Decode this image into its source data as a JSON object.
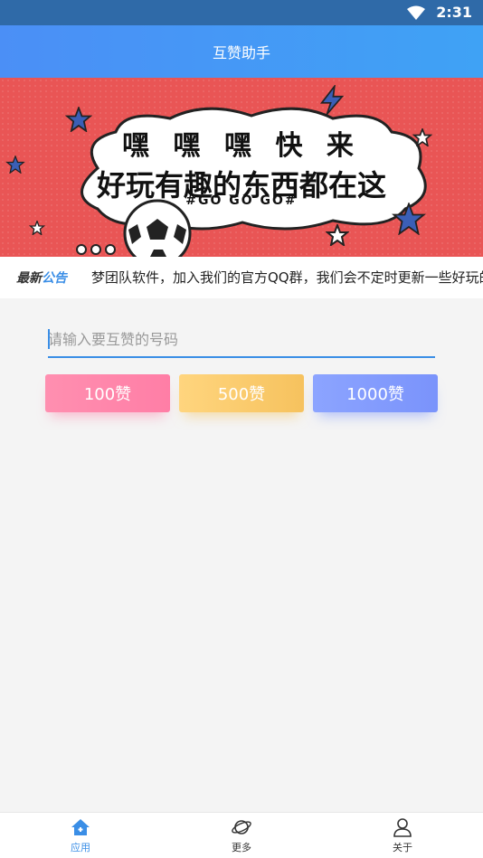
{
  "status_bar": {
    "time": "2:31",
    "wifi_icon": "wifi-icon"
  },
  "app_bar": {
    "title": "互赞助手"
  },
  "banner": {
    "line1": "嘿 嘿 嘿 快 来",
    "line2": "好玩有趣的东西都在这",
    "line3": "#GO GO GO#"
  },
  "notice": {
    "tag_part1": "最新",
    "tag_part2": "公告",
    "text": "梦团队软件，加入我们的官方QQ群，我们会不定时更新一些好玩的东西"
  },
  "input": {
    "placeholder": "请输入要互赞的号码",
    "value": ""
  },
  "buttons": [
    {
      "label": "100赞",
      "color": "#ff86ab"
    },
    {
      "label": "500赞",
      "color": "#f8c866"
    },
    {
      "label": "1000赞",
      "color": "#8199fc"
    }
  ],
  "bottom_nav": [
    {
      "label": "应用",
      "icon": "home-icon",
      "active": true
    },
    {
      "label": "更多",
      "icon": "planet-icon",
      "active": false
    },
    {
      "label": "关于",
      "icon": "person-icon",
      "active": false
    }
  ],
  "colors": {
    "accent": "#3a8ee6",
    "appbar": "#4b8ff6",
    "banner": "#e95555"
  }
}
